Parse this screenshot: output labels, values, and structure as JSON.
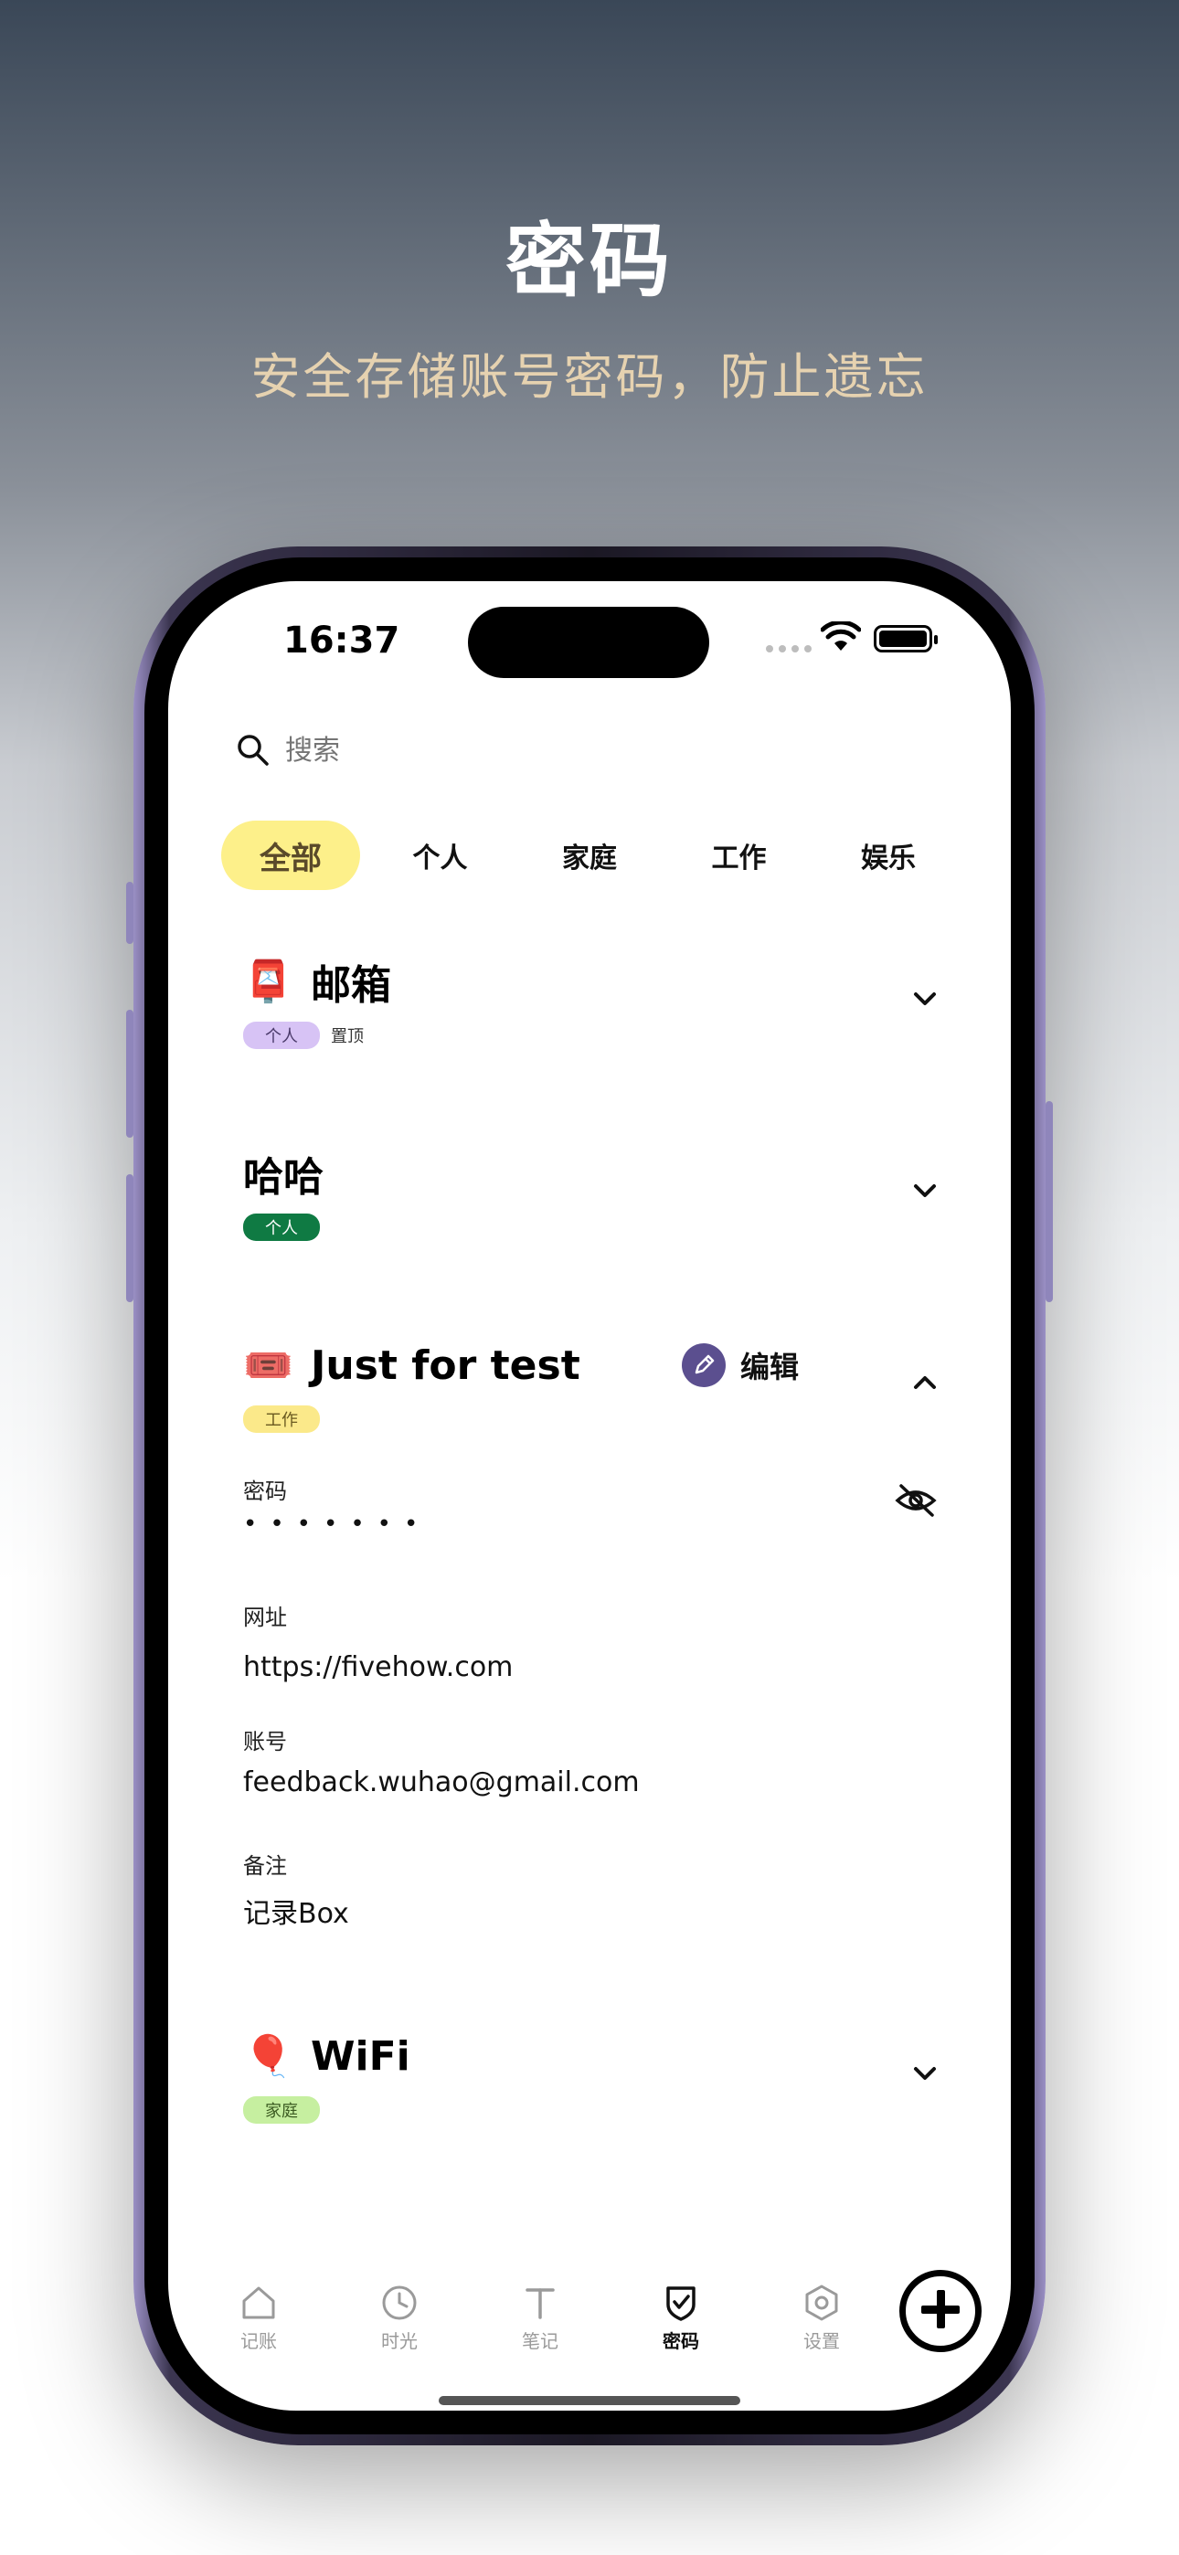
{
  "hero": {
    "title": "密码",
    "subtitle": "安全存储账号密码，防止遗忘"
  },
  "status_bar": {
    "time": "16:37"
  },
  "search": {
    "placeholder": "搜索"
  },
  "tabs": [
    {
      "label": "全部",
      "active": true
    },
    {
      "label": "个人",
      "active": false
    },
    {
      "label": "家庭",
      "active": false
    },
    {
      "label": "工作",
      "active": false
    },
    {
      "label": "娱乐",
      "active": false
    }
  ],
  "entries": [
    {
      "icon": "postbox-icon",
      "emoji": "📮",
      "title": "邮箱",
      "tag": "个人",
      "tag_color": "#d7c3f5",
      "pinned_label": "置顶",
      "expanded": false
    },
    {
      "icon": "",
      "emoji": "",
      "title": "哈哈",
      "tag": "个人",
      "tag_color": "#0f7a43",
      "expanded": false
    },
    {
      "icon": "ticket-icon",
      "emoji": "🎟️",
      "title": "Just for test",
      "tag": "工作",
      "tag_color": "#fbe98a",
      "expanded": true,
      "edit_label": "编辑",
      "fields": {
        "password_label": "密码",
        "password_masked": "•••••••",
        "url_label": "网址",
        "url_value": "https://fivehow.com",
        "account_label": "账号",
        "account_value": "feedback.wuhao@gmail.com",
        "note_label": "备注",
        "note_value": "记录Box"
      }
    },
    {
      "icon": "balloon-icon",
      "emoji": "🎈",
      "title": "WiFi",
      "tag": "家庭",
      "tag_color": "#c6efa0",
      "expanded": false
    }
  ],
  "tabbar": {
    "items": [
      {
        "label": "记账",
        "icon": "home-icon",
        "active": false
      },
      {
        "label": "时光",
        "icon": "clock-icon",
        "active": false
      },
      {
        "label": "笔记",
        "icon": "text-icon",
        "active": false
      },
      {
        "label": "密码",
        "icon": "shield-check-icon",
        "active": true
      },
      {
        "label": "设置",
        "icon": "hexagon-settings-icon",
        "active": false
      }
    ],
    "add_icon": "plus-circle-icon"
  },
  "colors": {
    "active_tab_bg": "#fdf08a",
    "edit_accent": "#5b4f8f",
    "subtitle": "#e6d2b0"
  }
}
